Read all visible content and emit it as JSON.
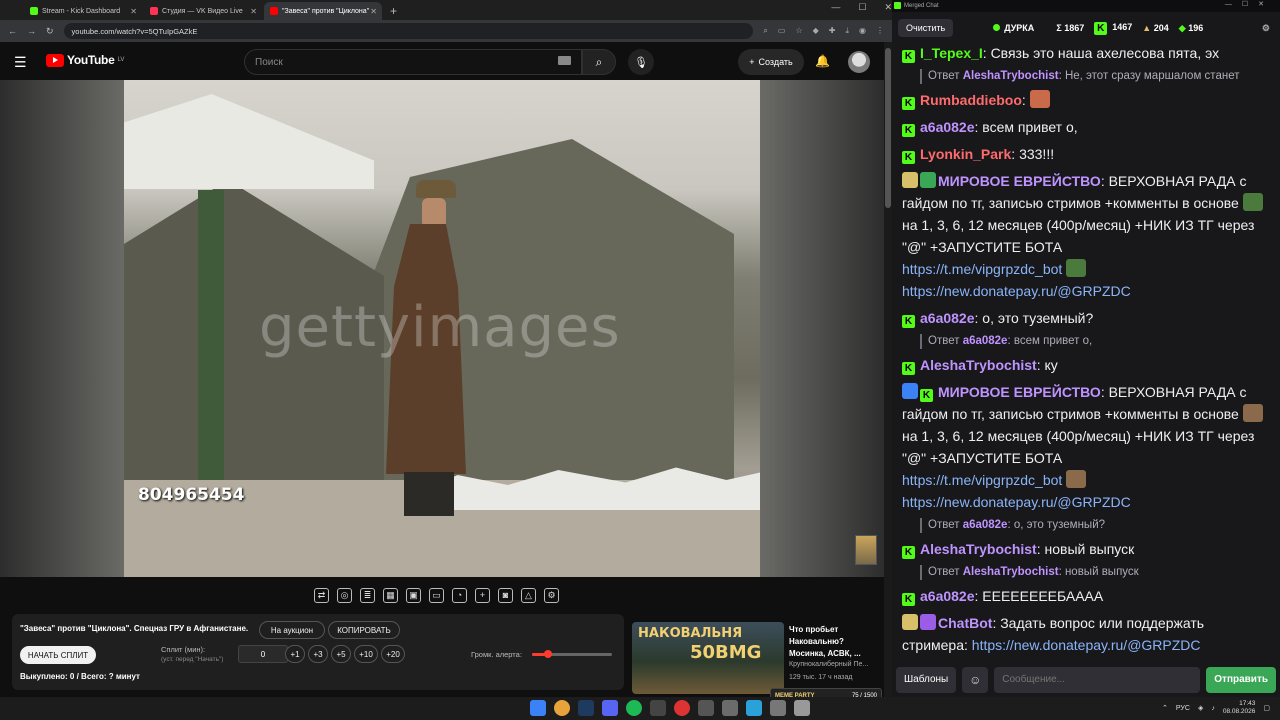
{
  "browser": {
    "tabs": [
      {
        "title": "Stream - Kick Dashboard",
        "color": "#53fc18",
        "active": false
      },
      {
        "title": "Студия — VK Видео Live",
        "color": "#ff3355",
        "active": false
      },
      {
        "title": "\"Завеса\" против \"Циклона\"",
        "color": "#ff0000",
        "active": true
      }
    ],
    "url": "youtube.com/watch?v=5QTuIpGAZkE"
  },
  "youtube": {
    "logo_text": "YouTube",
    "region": "LV",
    "search_placeholder": "Поиск",
    "create_label": "Создать"
  },
  "video": {
    "watermark": "gettyimages",
    "image_id": "804965454"
  },
  "panel": {
    "title": "\"Завеса\" против \"Циклона\". Спецназ ГРУ в Афганистане.",
    "auction_label": "На аукцион",
    "copy_label": "КОПИРОВАТЬ",
    "start_split_label": "НАЧАТЬ СПЛИТ",
    "split_label": "Сплит (мин):",
    "split_hint": "(уст. перед \"Начать\")",
    "split_value": "0",
    "increments": [
      "+1",
      "+3",
      "+5",
      "+10",
      "+20"
    ],
    "bought_text": "Выкуплено: 0 / Всего: ? минут",
    "volume_label": "Громк. алерта:",
    "volume_level": 0.2
  },
  "recommendation": {
    "thumb_line1": "НАКОВАЛЬНЯ",
    "thumb_line2": "50BMG",
    "title": "Что пробьет Наковальню? Мосинка, АСВК, ...",
    "channel": "Крупнокалиберный Пе...",
    "meta": "129 тыс.  17 ч назад",
    "meme_label": "MEME PARTY",
    "meme_count": "75 / 1500"
  },
  "chat": {
    "window_title": "Merged Chat",
    "clear_label": "Очистить",
    "channel": "ДУРКА",
    "stats": [
      {
        "icon": "sigma-icon",
        "text": "Σ 1867"
      },
      {
        "icon": "kick-icon",
        "text": "1467"
      },
      {
        "icon": "twitch-icon",
        "text": "204"
      },
      {
        "icon": "vk-icon",
        "text": "196"
      }
    ],
    "messages": [
      {
        "type": "msg",
        "user": "I_Tepex_I",
        "color": "u-green",
        "badge": "K",
        "text": "Связь это наша ахелесова пята, эх"
      },
      {
        "type": "reply",
        "user": "AleshaTrybochist",
        "text": "Не, этот сразу маршалом станет"
      },
      {
        "type": "msg",
        "user": "Rumbaddieboo",
        "color": "u-red",
        "badge": "K",
        "text": "",
        "emote": "#c96b4a"
      },
      {
        "type": "msg",
        "user": "a6a082e",
        "color": "u-purple",
        "badge": "K",
        "text": "всем привет о,"
      },
      {
        "type": "msg",
        "user": "Lyonkin_Park",
        "color": "u-red",
        "badge": "K",
        "text": "333!!!"
      },
      {
        "type": "msg",
        "user": "МИРОВОЕ ЕВРЕЙСТВО",
        "color": "u-purple",
        "badge": "",
        "prefix_icons": [
          "#d8c06a",
          "#3aa757"
        ],
        "text": "ВЕРХОВНАЯ РАДА с гайдом по тг, записью стримов +комменты в основе",
        "emote": "#4b7b3c",
        "text2": "на 1, 3, 6, 12 месяцев (400р/месяц) +НИК ИЗ ТГ через \"@\" +ЗАПУСТИТЕ БОТА",
        "link1": "https://t.me/vipgrpzdc_bot",
        "link2": "https://new.donatepay.ru/@GRPZDC"
      },
      {
        "type": "msg",
        "user": "a6a082e",
        "color": "u-purple",
        "badge": "K",
        "text": "о, это туземный?"
      },
      {
        "type": "reply",
        "user": "a6a082e",
        "text": "всем привет о,"
      },
      {
        "type": "msg",
        "user": "AleshaTrybochist",
        "color": "u-purple",
        "badge": "K",
        "text": "ку"
      },
      {
        "type": "msg",
        "user": "МИРОВОЕ ЕВРЕЙСТВО",
        "color": "u-purple",
        "badge": "K",
        "prefix_icons": [
          "#3b82f6"
        ],
        "text": "ВЕРХОВНАЯ РАДА с гайдом по тг, записью стримов +комменты в основе",
        "emote": "#8a6a4a",
        "text2": "на 1, 3, 6, 12 месяцев (400р/месяц) +НИК ИЗ ТГ через \"@\" +ЗАПУСТИТЕ БОТА",
        "link1": "https://t.me/vipgrpzdc_bot",
        "link2": "https://new.donatepay.ru/@GRPZDC"
      },
      {
        "type": "reply",
        "user": "a6a082e",
        "text": "о, это туземный?"
      },
      {
        "type": "msg",
        "user": "AleshaTrybochist",
        "color": "u-purple",
        "badge": "K",
        "text": "новый выпуск"
      },
      {
        "type": "reply",
        "user": "AleshaTrybochist",
        "text": "новый выпуск"
      },
      {
        "type": "msg",
        "user": "a6a082e",
        "color": "u-purple",
        "badge": "K",
        "text": "ЕЕЕЕЕЕЕЕБАААА"
      },
      {
        "type": "msg",
        "user": "ChatBot",
        "color": "u-purple",
        "badge": "",
        "prefix_icons": [
          "#d8c06a",
          "#9b5de5"
        ],
        "text": "Задать вопрос или поддержать стримера:",
        "link1": "https://new.donatepay.ru/@GRPZDC",
        "inline_link": true
      }
    ],
    "reply_prefix": "Ответ",
    "templates_label": "Шаблоны",
    "input_placeholder": "Сообщение...",
    "send_label": "Отправить"
  },
  "taskbar": {
    "lang": "РУС",
    "time": "17:43",
    "date": "08.08.2026"
  }
}
